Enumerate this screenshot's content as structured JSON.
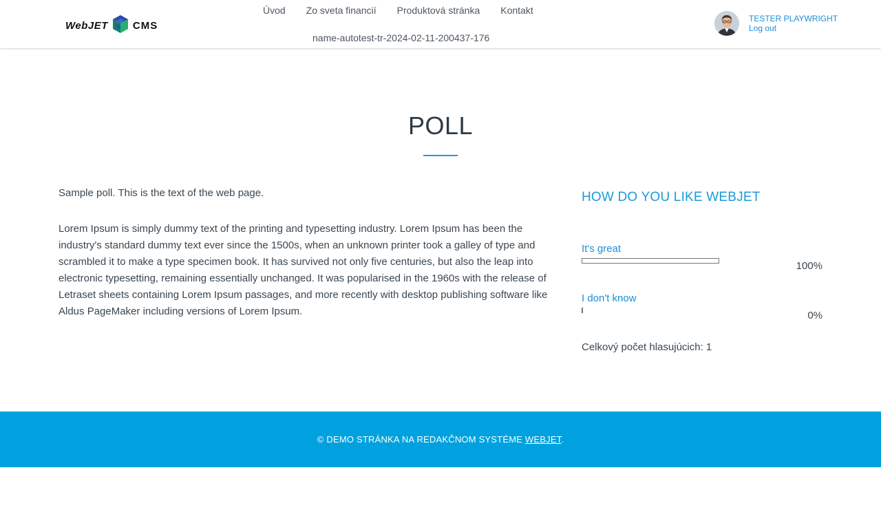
{
  "header": {
    "logo": {
      "word": "WebJET",
      "suffix": "CMS"
    },
    "nav": [
      "Úvod",
      "Zo sveta financií",
      "Produktová stránka",
      "Kontakt"
    ],
    "nav_second_row": "name-autotest-tr-2024-02-11-200437-176",
    "user": {
      "name": "TESTER PLAYWRIGHT",
      "logout": "Log out"
    }
  },
  "page": {
    "title": "POLL",
    "intro": "Sample poll. This is the text of the web page.",
    "body": "Lorem Ipsum is simply dummy text of the printing and typesetting industry. Lorem Ipsum has been the industry's standard dummy text ever since the 1500s, when an unknown printer took a galley of type and scrambled it to make a type specimen book. It has survived not only five centuries, but also the leap into electronic typesetting, remaining essentially unchanged. It was popularised in the 1960s with the release of Letraset sheets containing Lorem Ipsum passages, and more recently with desktop publishing software like Aldus PageMaker including versions of Lorem Ipsum."
  },
  "poll": {
    "question": "HOW DO YOU LIKE WEBJET",
    "answers": [
      {
        "label": "It's great",
        "percent": "100%",
        "fraction": 1.0
      },
      {
        "label": "I don't know",
        "percent": "0%",
        "fraction": 0.0
      }
    ],
    "total": "Celkový počet hlasujúcich: 1"
  },
  "footer": {
    "text": "© DEMO STRÁNKA NA REDAKČNOM SYSTÉME ",
    "link": "WEBJET",
    "tail": "."
  },
  "colors": {
    "accent": "#1a9ad6",
    "footer_bg": "#00a1de",
    "text": "#3a4650"
  }
}
